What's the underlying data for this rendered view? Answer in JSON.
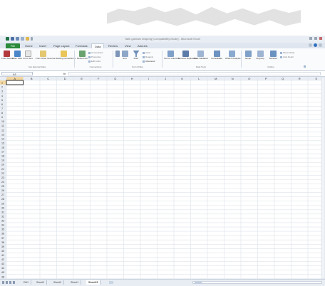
{
  "window": {
    "title": "Tarik gambar imajeng  [Compatibility Mode] - Microsoft Excel",
    "quick_access": [
      "save-icon",
      "undo-icon",
      "redo-icon",
      "customize-icon"
    ],
    "controls": [
      "minimize-icon",
      "restore-icon",
      "close-icon"
    ]
  },
  "tabs": [
    {
      "label": "File"
    },
    {
      "label": "Home"
    },
    {
      "label": "Insert"
    },
    {
      "label": "Page Layout"
    },
    {
      "label": "Formulas"
    },
    {
      "label": "Data"
    },
    {
      "label": "Review"
    },
    {
      "label": "View"
    },
    {
      "label": "Add-Ins"
    }
  ],
  "active_tab": "Data",
  "ribbon": {
    "groups": [
      {
        "label": "Get External Data",
        "buttons": [
          "From Access",
          "From Web",
          "From Text",
          "From Other Sources",
          "Existing Connections"
        ]
      },
      {
        "label": "Connections",
        "buttons": [
          "Refresh All"
        ],
        "small": [
          "Connections",
          "Properties",
          "Edit Links"
        ]
      },
      {
        "label": "Sort & Filter",
        "buttons": [
          "Sort",
          "Filter"
        ],
        "small": [
          "Clear",
          "Reapply",
          "Advanced"
        ]
      },
      {
        "label": "Data Tools",
        "buttons": [
          "Text to Columns",
          "Remove Duplicates",
          "Data Validation",
          "Consolidate",
          "What-If Analysis"
        ]
      },
      {
        "label": "Outline",
        "buttons": [
          "Group",
          "Ungroup",
          "Subtotal"
        ],
        "small": [
          "Show Detail",
          "Hide Detail"
        ]
      }
    ]
  },
  "formula_bar": {
    "name_box": "A1",
    "fx": "fx",
    "value": ""
  },
  "columns": [
    "A",
    "B",
    "C",
    "D",
    "E",
    "F",
    "G",
    "H",
    "I",
    "J",
    "K",
    "L",
    "M",
    "N",
    "O",
    "P",
    "Q",
    "R",
    "S"
  ],
  "row_count": 46,
  "sheets": [
    "DIKI",
    "Sheet2",
    "Sheet9",
    "Sheet1",
    "Sheet15"
  ],
  "active_sheet": "Sheet15",
  "colors": {
    "file_tab": "#2a8a3a",
    "header_bg": "#e9eef5",
    "gridline": "#dde3ea",
    "selected_header": "#f3d7a1"
  }
}
